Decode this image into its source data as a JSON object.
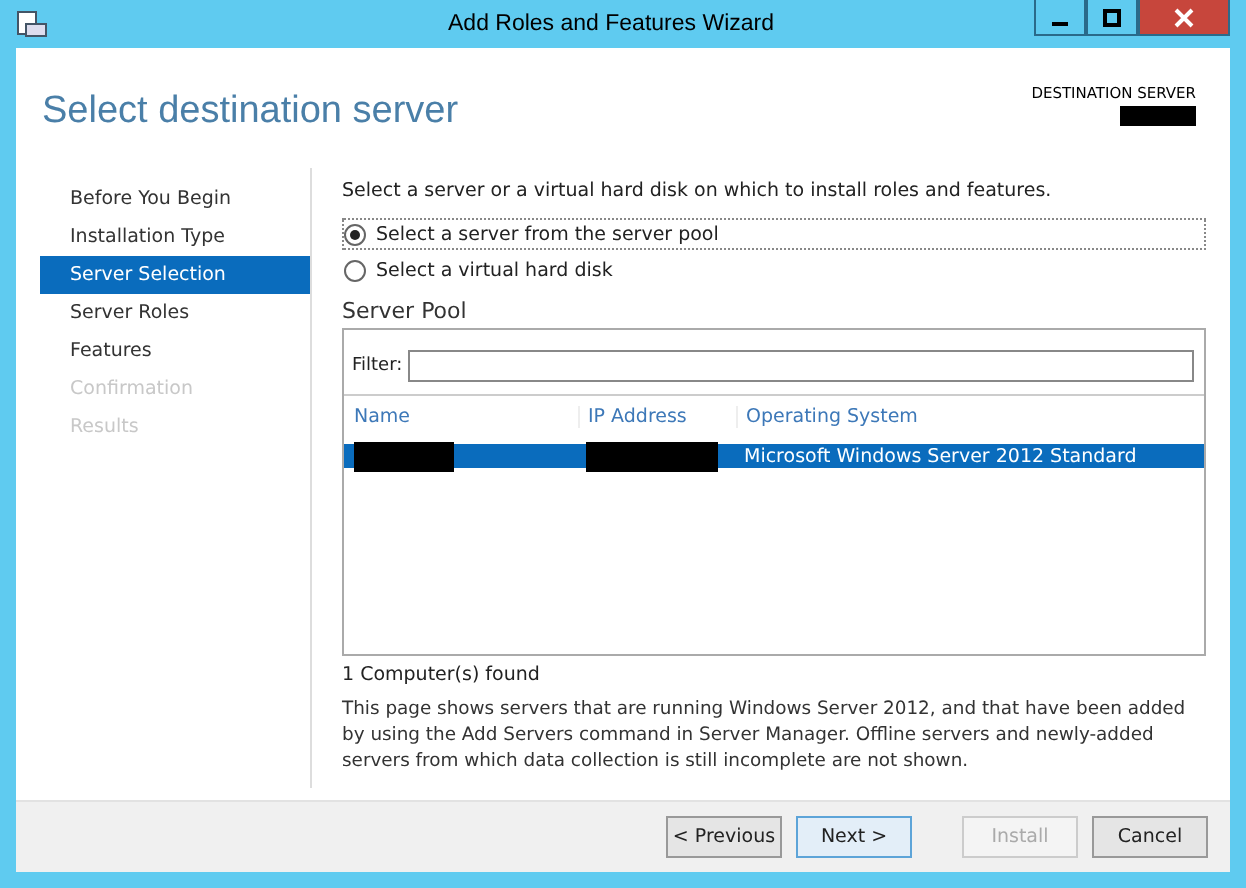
{
  "window": {
    "title": "Add Roles and Features Wizard"
  },
  "page_title": "Select destination server",
  "destination_server": {
    "label": "DESTINATION SERVER",
    "redacted": true
  },
  "steps": [
    {
      "label": "Before You Begin",
      "selected": false,
      "disabled": false
    },
    {
      "label": "Installation Type",
      "selected": false,
      "disabled": false
    },
    {
      "label": "Server Selection",
      "selected": true,
      "disabled": false
    },
    {
      "label": "Server Roles",
      "selected": false,
      "disabled": false
    },
    {
      "label": "Features",
      "selected": false,
      "disabled": false
    },
    {
      "label": "Confirmation",
      "selected": false,
      "disabled": true
    },
    {
      "label": "Results",
      "selected": false,
      "disabled": true
    }
  ],
  "instruction": "Select a server or a virtual hard disk on which to install roles and features.",
  "options": [
    {
      "label": "Select a server from the server pool",
      "selected": true
    },
    {
      "label": "Select a virtual hard disk",
      "selected": false
    }
  ],
  "server_pool": {
    "title": "Server Pool",
    "filter_label": "Filter:",
    "columns": [
      "Name",
      "IP Address",
      "Operating System"
    ],
    "rows": [
      {
        "selected": true,
        "cells": [
          {
            "redacted": true
          },
          {
            "redacted": true
          },
          {
            "text": "Microsoft Windows Server 2012 Standard",
            "redacted": false
          }
        ]
      }
    ],
    "count": "1 Computer(s) found"
  },
  "note": "This page shows servers that are running Windows Server 2012, and that have been added by using the Add Servers command in Server Manager. Offline servers and newly-added servers from which data collection is still incomplete are not shown.",
  "buttons": [
    {
      "label": "< Previous",
      "disabled": false,
      "focused": false
    },
    {
      "label": "Next >",
      "disabled": false,
      "focused": true
    },
    {
      "label": "Install",
      "disabled": true,
      "focused": false
    },
    {
      "label": "Cancel",
      "disabled": false,
      "focused": false
    }
  ]
}
